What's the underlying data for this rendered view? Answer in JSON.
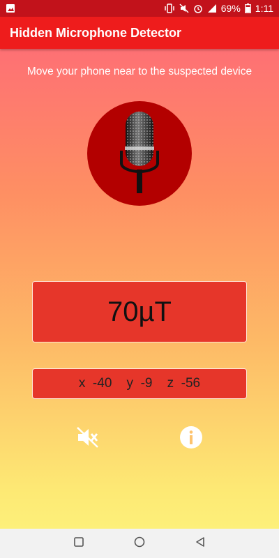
{
  "status_bar": {
    "battery": "69%",
    "time": "1:11",
    "icons": [
      "image-icon",
      "vibrate-icon",
      "mute-icon",
      "alarm-icon",
      "signal-icon",
      "battery-icon"
    ]
  },
  "app_bar": {
    "title": "Hidden Microphone Detector"
  },
  "main": {
    "hint": "Move your phone near to the suspected device",
    "reading": "70µT",
    "axes": "x  -40    y  -9    z  -56"
  },
  "controls": {
    "icons": [
      "volume-mute-icon",
      "info-icon"
    ]
  },
  "nav": {
    "icons": [
      "recents-square-icon",
      "home-circle-icon",
      "back-triangle-icon"
    ]
  },
  "colors": {
    "status_bar": "#c2121b",
    "app_bar": "#ee1c1c",
    "mic_circle": "#b30000",
    "box_fill": "#e6362a"
  }
}
